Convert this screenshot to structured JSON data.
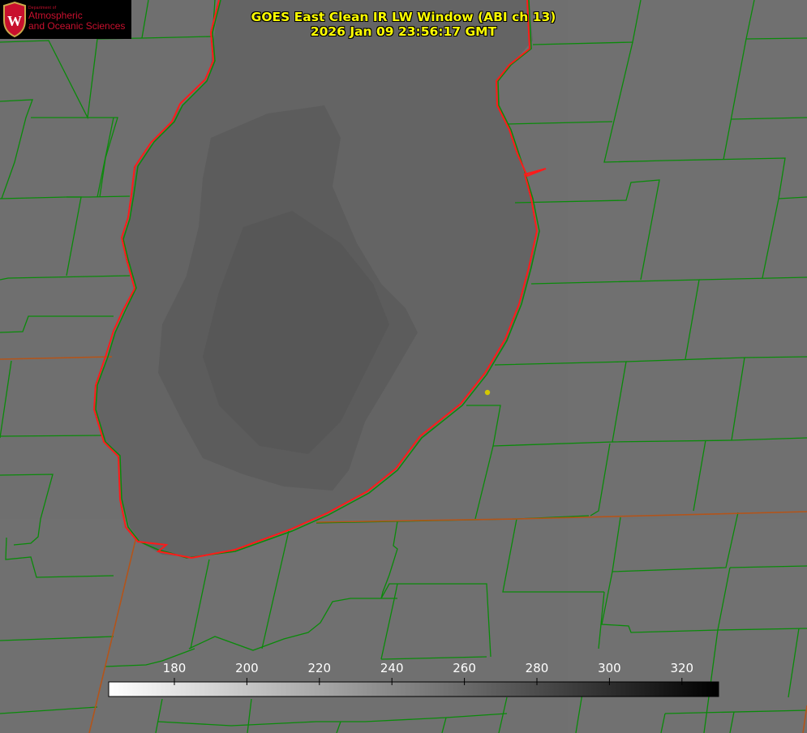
{
  "header": {
    "title": "GOES East Clean IR LW Window (ABI ch 13)",
    "timestamp": "2026 Jan 09 23:56:17 GMT"
  },
  "logo": {
    "department": "Department of",
    "line1": "Atmospheric",
    "line2": "and Oceanic Sciences",
    "crest_letter": "W"
  },
  "colorbar": {
    "tick_labels": [
      "180",
      "200",
      "220",
      "240",
      "260",
      "280",
      "300",
      "320"
    ],
    "gradient": "white-to-black"
  },
  "colors": {
    "background_gray": "#6f6f6f",
    "lake_gray": "#646464",
    "county_lines": "#0a8a0a",
    "coastline": "#ff1a1a",
    "state_border": "#b3541a",
    "title_text": "#ffff00",
    "station_dot": "#d4c800",
    "logo_red": "#c8102e"
  },
  "icons": [
    "university-crest-icon",
    "station-marker-icon"
  ]
}
